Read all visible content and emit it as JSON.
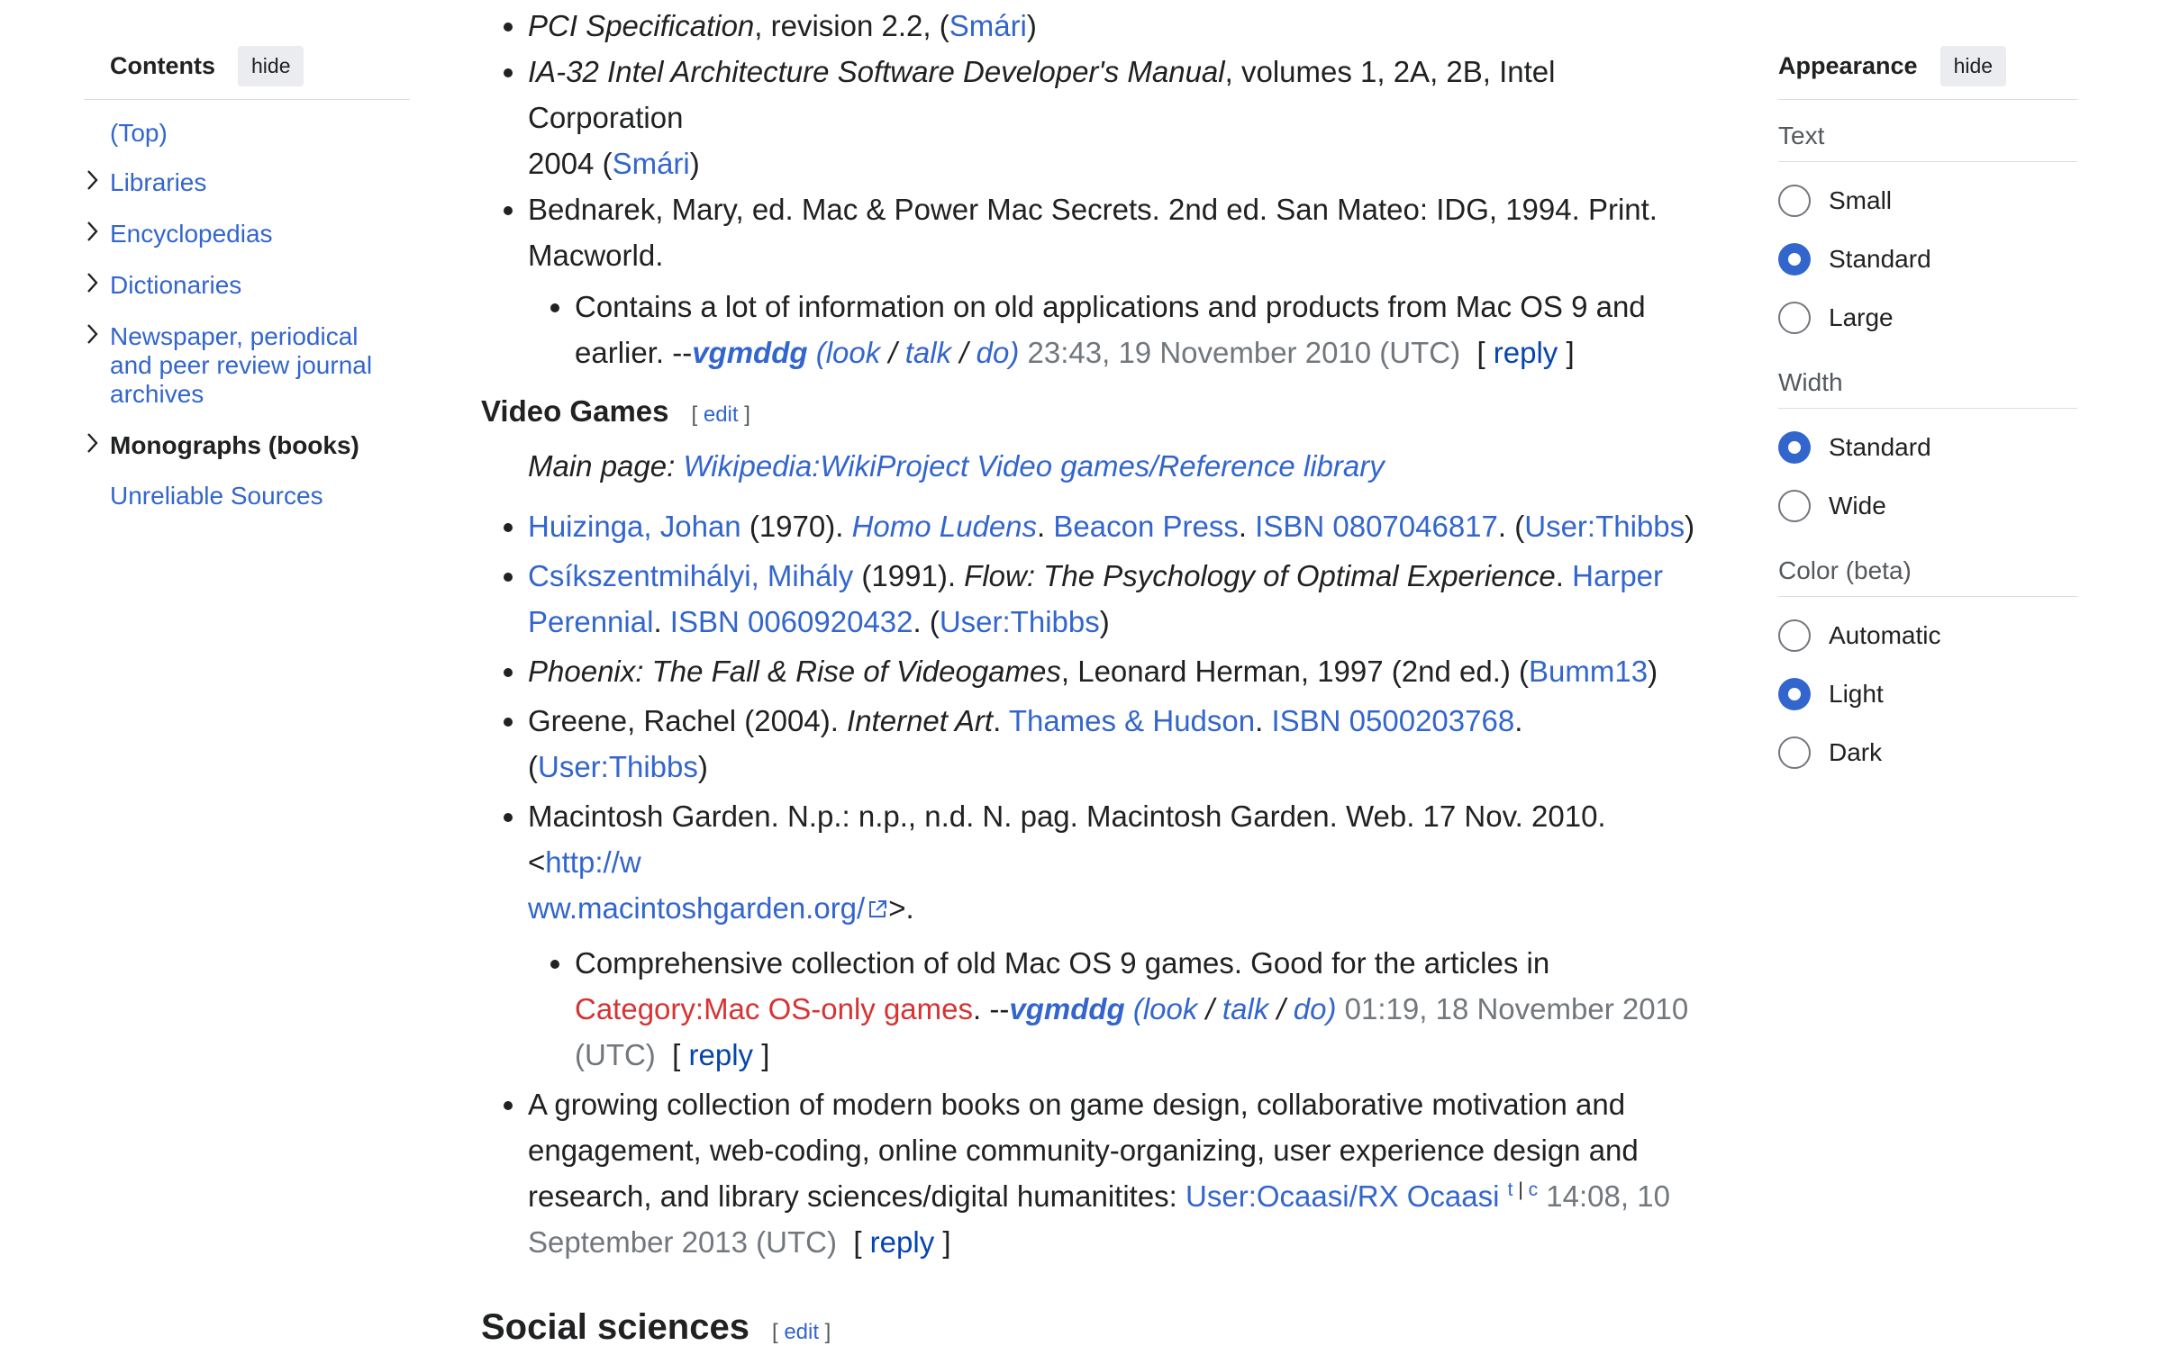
{
  "toc": {
    "title": "Contents",
    "hide_label": "hide",
    "items": [
      {
        "label": "(Top)"
      },
      {
        "label": "Libraries"
      },
      {
        "label": "Encyclopedias"
      },
      {
        "label": "Dictionaries"
      },
      {
        "label": "Newspaper, periodical and peer review journal archives"
      },
      {
        "label": "Monographs (books)"
      },
      {
        "label": "Unreliable Sources"
      }
    ]
  },
  "main": {
    "top_items": {
      "pci_title": "PCI Specification",
      "pci_rest": ", revision 2.2, (",
      "pci_user": "Smári",
      "ia32_title": "IA-32 Intel Architecture Software Developer's Manual",
      "ia32_rest_1": ", volumes 1, 2A, 2B, Intel Corporation",
      "ia32_rest_2": "2004 (",
      "ia32_user": "Smári",
      "bednarek_1": "Bednarek, Mary, ed. Mac & Power Mac Secrets. 2nd ed. San Mateo: IDG, 1994. Print.",
      "bednarek_2": "Macworld.",
      "bednarek_comment_1": "Contains a lot of information on old applications and products from Mac OS 9 and",
      "bednarek_comment_2": "earlier. --",
      "sig_user": "vgmddg",
      "sig_look": "look",
      "sig_talk": "talk",
      "sig_do": "do",
      "sig_time_1": "23:43, 19 November 2010 (UTC)",
      "reply": "reply"
    },
    "video_games": {
      "heading": "Video Games",
      "edit": "edit",
      "main_page_label": "Main page: ",
      "main_page_link": "Wikipedia:WikiProject Video games/Reference library",
      "huizinga_author": "Huizinga, Johan",
      "huizinga_year": " (1970). ",
      "huizinga_title": "Homo Ludens",
      "huizinga_publisher": "Beacon Press",
      "huizinga_isbn": "ISBN 0807046817",
      "user_thibbs": "User:Thibbs",
      "csik_author": "Csíkszentmihályi, Mihály",
      "csik_year": " (1991). ",
      "csik_title": "Flow: The Psychology of Optimal Experience",
      "csik_pub_1": "Harper",
      "csik_pub_2": "Perennial",
      "csik_isbn": "ISBN 0060920432",
      "phoenix_title": "Phoenix: The Fall & Rise of Videogames",
      "phoenix_rest": ", Leonard Herman, 1997 (2nd ed.) (",
      "phoenix_user": "Bumm13",
      "greene_author": "Greene, Rachel (2004). ",
      "greene_title": "Internet Art",
      "greene_publisher": "Thames & Hudson",
      "greene_isbn": "ISBN 0500203768",
      "mg_text": "Macintosh Garden. N.p.: n.p., n.d. N. pag. Macintosh Garden. Web. 17 Nov. 2010. <",
      "mg_url_1": "http://w",
      "mg_url_2": "ww.macintoshgarden.org/",
      "mg_comment_1": "Comprehensive collection of old Mac OS 9 games. Good for the articles in",
      "mg_category": "Category:Mac OS-only games",
      "mg_time": "01:19, 18 November 2010",
      "mg_utc": "(UTC)",
      "ocaasi_1": "A growing collection of modern books on game design, collaborative motivation and",
      "ocaasi_2": "engagement, web-coding, online community-organizing, user experience design and",
      "ocaasi_3": "research, and library sciences/digital humanitites: ",
      "ocaasi_user": "User:Ocaasi/RX Ocaasi",
      "ocaasi_t": "t",
      "ocaasi_c": "c",
      "ocaasi_time_1": "14:08, 10",
      "ocaasi_time_2": "September 2013 (UTC)"
    },
    "social": {
      "heading": "Social sciences",
      "edit": "edit"
    }
  },
  "appearance": {
    "title": "Appearance",
    "hide_label": "hide",
    "text_group": "Text",
    "text_options": [
      "Small",
      "Standard",
      "Large"
    ],
    "text_selected": "Standard",
    "width_group": "Width",
    "width_options": [
      "Standard",
      "Wide"
    ],
    "width_selected": "Standard",
    "color_group": "Color (beta)",
    "color_options": [
      "Automatic",
      "Light",
      "Dark"
    ],
    "color_selected": "Light"
  },
  "colors": {
    "link": "#3366cc",
    "redlink": "#d73333",
    "accent": "#3366cc"
  }
}
